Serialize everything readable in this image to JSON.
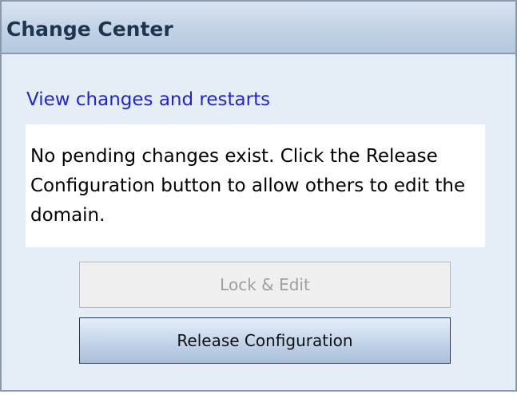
{
  "panel": {
    "title": "Change Center",
    "view_changes_link": "View changes and restarts",
    "message": "No pending changes exist. Click the Release Configuration button to allow others to edit the domain.",
    "buttons": {
      "lock_edit": "Lock & Edit",
      "release_configuration": "Release Configuration"
    }
  }
}
